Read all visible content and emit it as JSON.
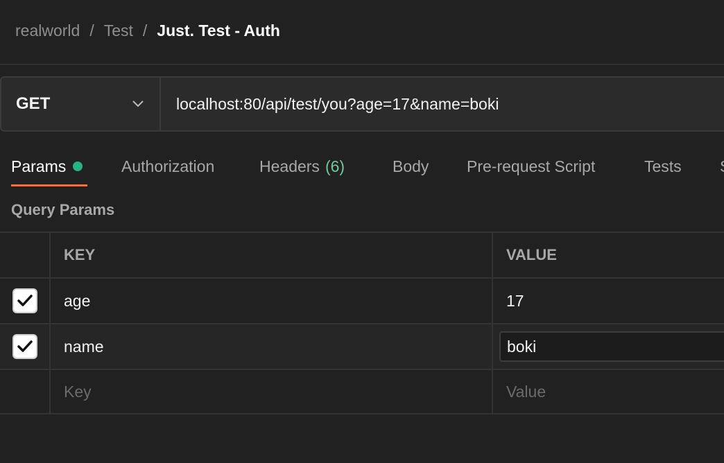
{
  "breadcrumb": {
    "items": [
      "realworld",
      "Test"
    ],
    "separator": "/",
    "current": "Just. Test - Auth"
  },
  "request": {
    "method": "GET",
    "url": "localhost:80/api/test/you?age=17&name=boki"
  },
  "tabs": [
    {
      "label": "Params",
      "active": true,
      "has_indicator": true
    },
    {
      "label": "Authorization"
    },
    {
      "label": "Headers",
      "count": "(6)"
    },
    {
      "label": "Body"
    },
    {
      "label": "Pre-request Script"
    },
    {
      "label": "Tests"
    },
    {
      "label": "S"
    }
  ],
  "query_params": {
    "title": "Query Params",
    "columns": {
      "key": "KEY",
      "value": "VALUE"
    },
    "rows": [
      {
        "checked": true,
        "key": "age",
        "value": "17"
      },
      {
        "checked": true,
        "key": "name",
        "value": "boki"
      }
    ],
    "new_row": {
      "key_placeholder": "Key",
      "value_placeholder": "Value"
    }
  },
  "colors": {
    "background": "#212121",
    "accent_underline": "#ff6c37",
    "indicator_dot": "#26b47f",
    "count": "#74c69d"
  }
}
